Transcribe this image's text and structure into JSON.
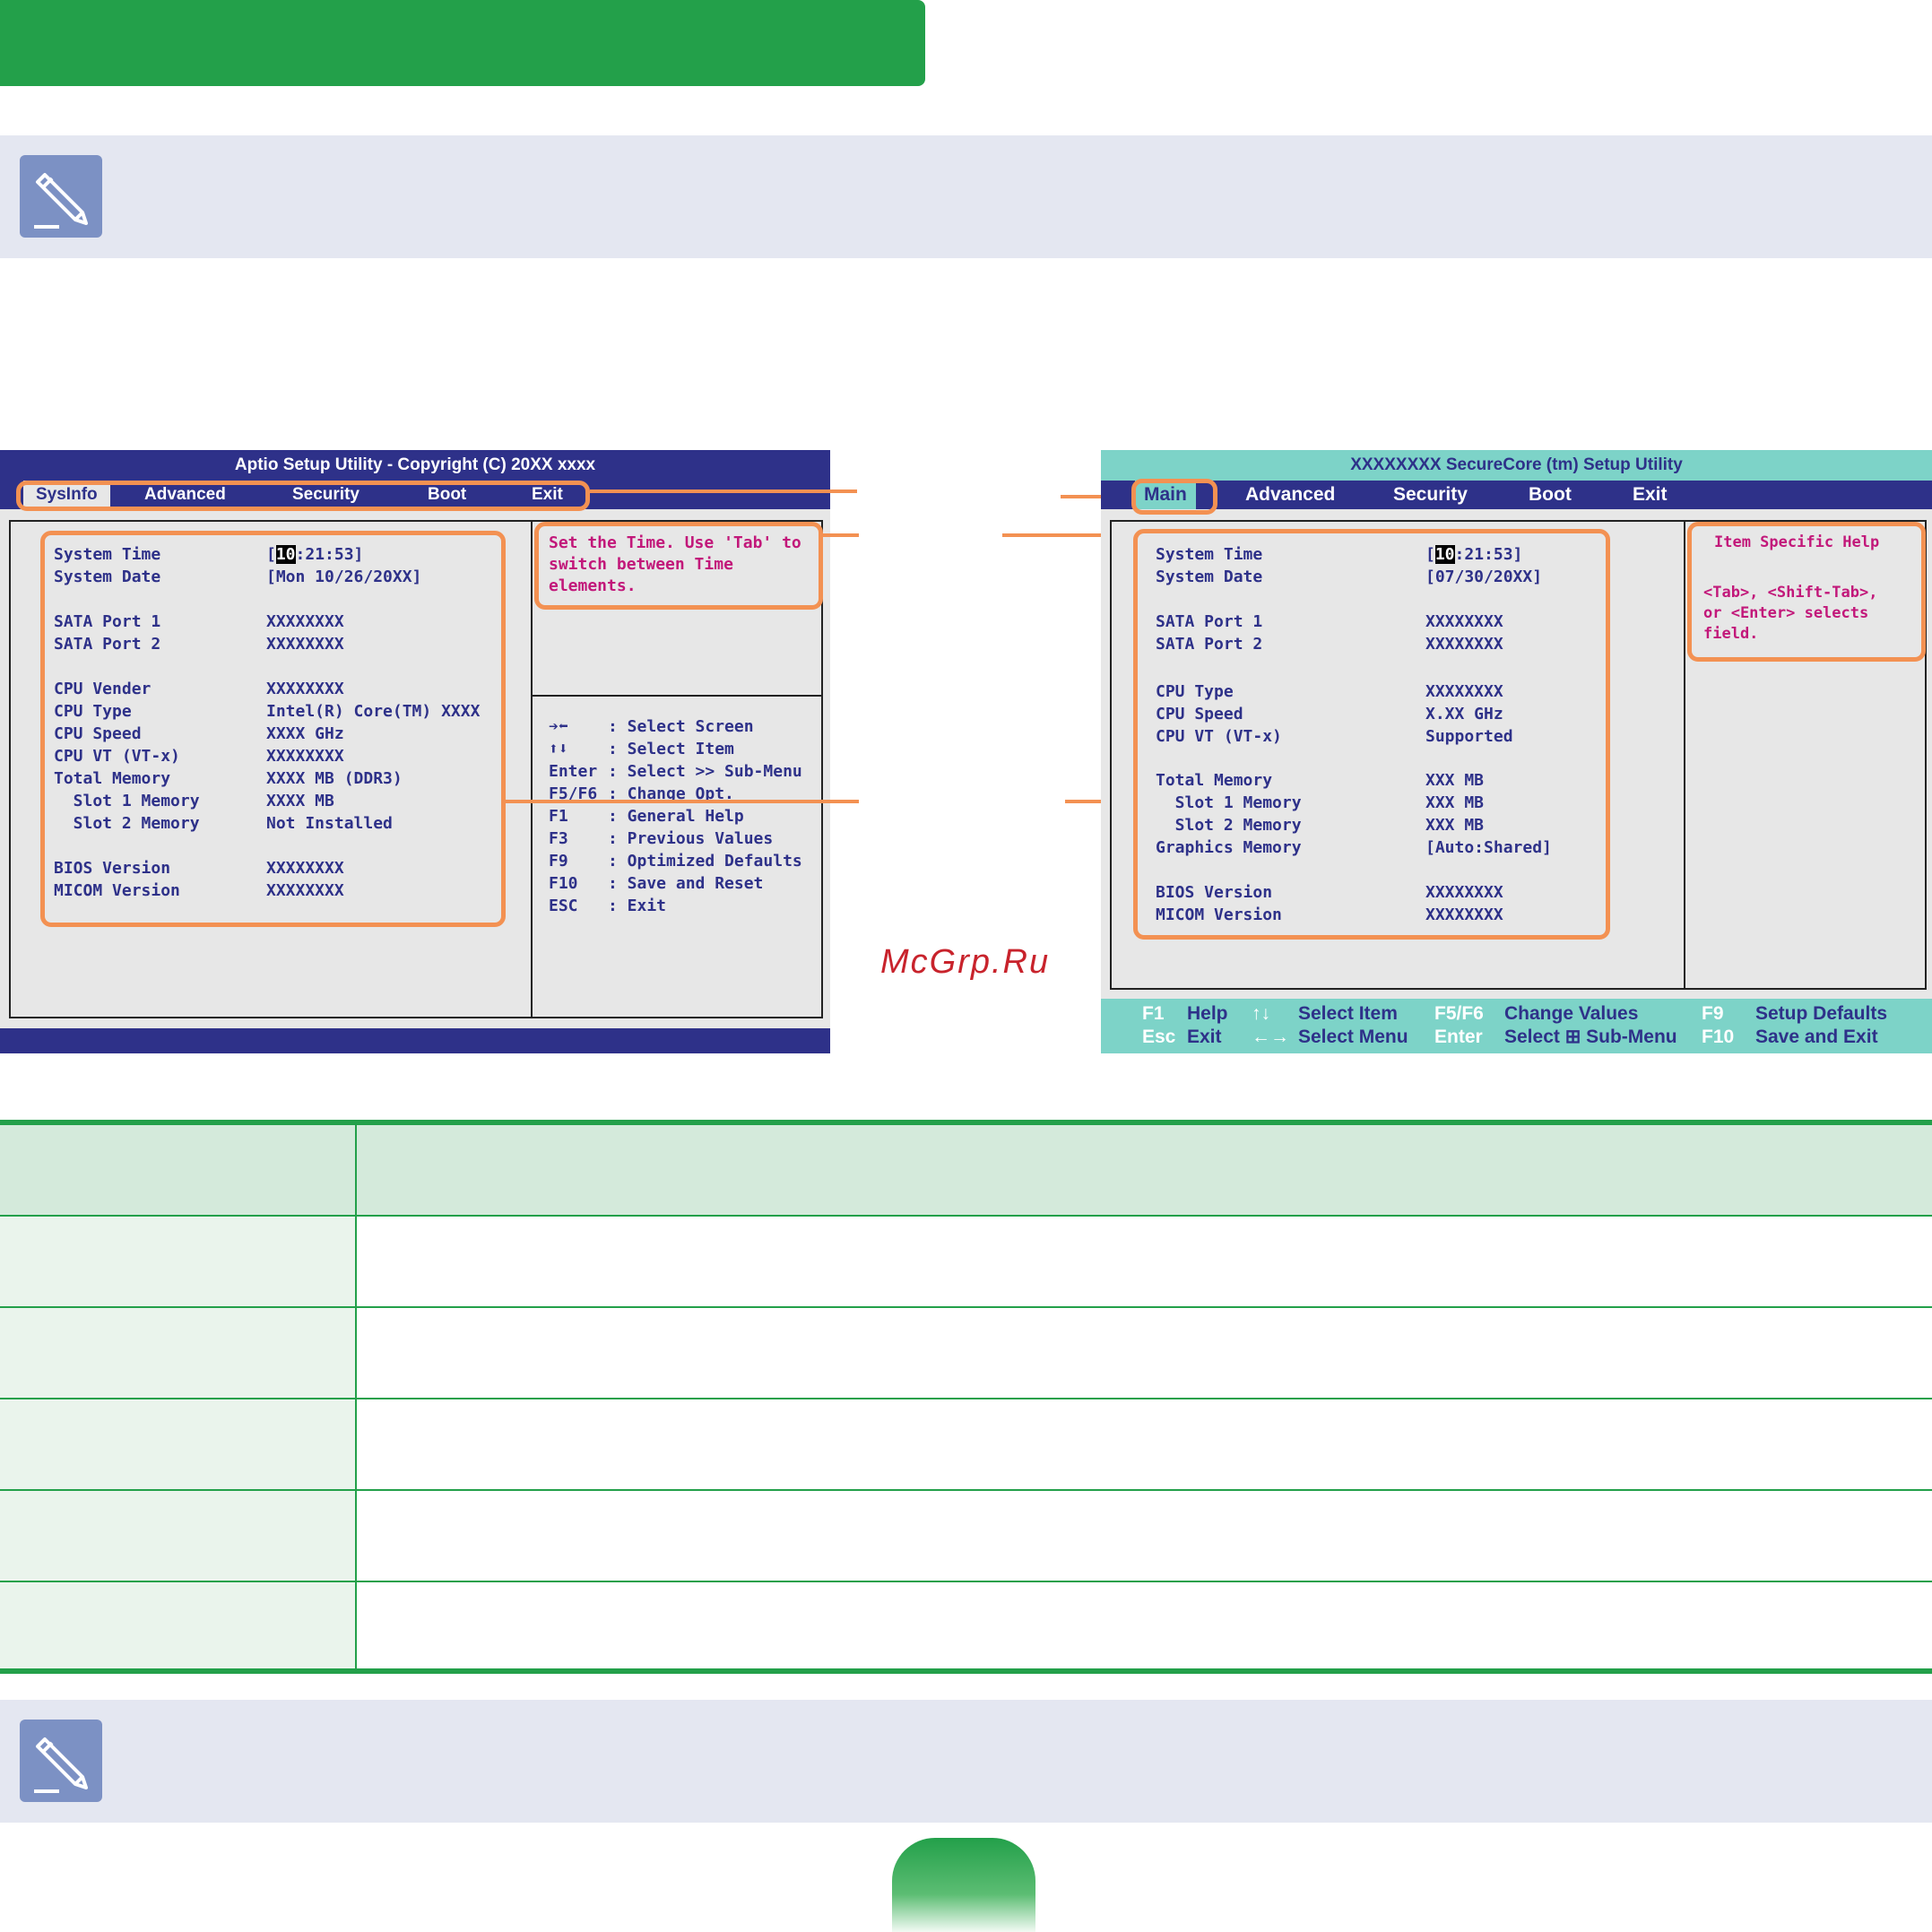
{
  "aptio": {
    "title": "Aptio Setup Utility - Copyright (C) 20XX xxxx",
    "tabs": [
      "SysInfo",
      "Advanced",
      "Security",
      "Boot",
      "Exit"
    ],
    "items": [
      {
        "label": "System Time",
        "value": ":21:53]",
        "cursor": "10",
        "prefix": "["
      },
      {
        "label": "System Date",
        "value": "[Mon 10/26/20XX]"
      },
      {
        "label": "SATA Port 1",
        "value": "XXXXXXXX"
      },
      {
        "label": "SATA Port 2",
        "value": "XXXXXXXX"
      },
      {
        "label": "CPU Vender",
        "value": "XXXXXXXX"
      },
      {
        "label": "CPU Type",
        "value": "Intel(R) Core(TM) XXXX"
      },
      {
        "label": "CPU Speed",
        "value": "XXXX GHz"
      },
      {
        "label": "CPU VT (VT-x)",
        "value": "XXXXXXXX"
      },
      {
        "label": "Total Memory",
        "value": "XXXX MB (DDR3)"
      },
      {
        "label": "  Slot 1 Memory",
        "value": "XXXX MB"
      },
      {
        "label": "  Slot 2 Memory",
        "value": "Not Installed"
      },
      {
        "label": "BIOS Version",
        "value": "XXXXXXXX"
      },
      {
        "label": "MICOM Version",
        "value": "XXXXXXXX"
      }
    ],
    "help_lines": [
      "Set the Time. Use 'Tab' to",
      "switch between Time",
      "elements."
    ],
    "keys": [
      {
        "key": "➔⬅",
        "desc": ": Select Screen"
      },
      {
        "key": "⬆⬇",
        "desc": ": Select Item"
      },
      {
        "key": "Enter",
        "desc": ": Select >> Sub-Menu"
      },
      {
        "key": "F5/F6",
        "desc": ": Change Opt."
      },
      {
        "key": "F1",
        "desc": ": General Help"
      },
      {
        "key": "F3",
        "desc": ": Previous Values"
      },
      {
        "key": "F9",
        "desc": ": Optimized Defaults"
      },
      {
        "key": "F10",
        "desc": ": Save and Reset"
      },
      {
        "key": "ESC",
        "desc": ": Exit"
      }
    ]
  },
  "securecore": {
    "title": "XXXXXXXX SecureCore (tm) Setup Utility",
    "tabs": [
      "Main",
      "Advanced",
      "Security",
      "Boot",
      "Exit"
    ],
    "items": [
      {
        "label": "System Time",
        "value": ":21:53]",
        "cursor": "10",
        "prefix": "["
      },
      {
        "label": "System Date",
        "value": "[07/30/20XX]"
      },
      {
        "label": "SATA Port 1",
        "value": "XXXXXXXX"
      },
      {
        "label": "SATA Port 2",
        "value": "XXXXXXXX"
      },
      {
        "label": "CPU Type",
        "value": "XXXXXXXX"
      },
      {
        "label": "CPU Speed",
        "value": "X.XX GHz"
      },
      {
        "label": "CPU VT (VT-x)",
        "value": "Supported"
      },
      {
        "label": "Total Memory",
        "value": "XXX MB"
      },
      {
        "label": "  Slot 1 Memory",
        "value": "XXX MB"
      },
      {
        "label": "  Slot 2 Memory",
        "value": "XXX MB"
      },
      {
        "label": "Graphics Memory",
        "value": "[Auto:Shared]"
      },
      {
        "label": "BIOS Version",
        "value": "XXXXXXXX"
      },
      {
        "label": "MICOM Version",
        "value": "XXXXXXXX"
      }
    ],
    "help_title": "Item Specific Help",
    "help_lines": [
      "<Tab>, <Shift-Tab>,",
      "or <Enter> selects",
      "field."
    ],
    "footer": {
      "row1": [
        {
          "key": "F1",
          "desc": "Help"
        },
        {
          "key": "↑↓",
          "desc": "Select Item"
        },
        {
          "key": "F5/F6",
          "desc": "Change Values"
        },
        {
          "key": "F9",
          "desc": "Setup Defaults"
        }
      ],
      "row2": [
        {
          "key": "Esc",
          "desc": "Exit"
        },
        {
          "key": "←→",
          "desc": "Select Menu"
        },
        {
          "key": "Enter",
          "desc": "Select ⊞ Sub-Menu"
        },
        {
          "key": "F10",
          "desc": "Save and Exit"
        }
      ]
    }
  },
  "watermark": "McGrp.Ru",
  "colors": {
    "green": "#23a04a",
    "note_band": "#e4e7f1",
    "note_icon": "#7c91c4",
    "bios_blue": "#2e3189",
    "bios_teal": "#7dd3c8",
    "highlight_orange": "#f39152",
    "help_magenta": "#c2187a"
  },
  "icons": [
    "pencil-note-icon"
  ]
}
